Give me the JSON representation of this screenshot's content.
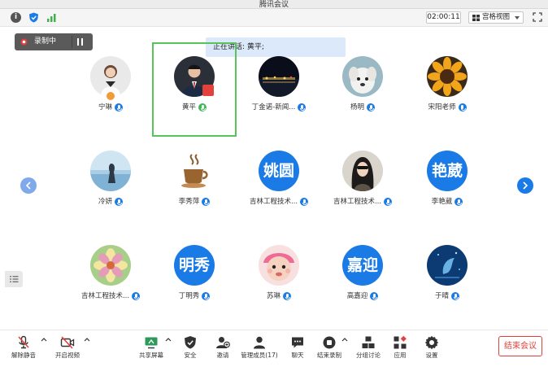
{
  "window": {
    "title": "腾讯会议"
  },
  "toolbar": {
    "timer": "02:00:11",
    "view_label": "宫格视图"
  },
  "recording": {
    "label": "录制中"
  },
  "speaking": {
    "text": "正在讲话: 黄平;"
  },
  "participants": [
    {
      "name": "宁琳",
      "avatar": "photo-woman"
    },
    {
      "name": "黄平",
      "avatar": "photo-man"
    },
    {
      "name": "丁金诺-新闻...",
      "avatar": "photo-night"
    },
    {
      "name": "杨明",
      "avatar": "photo-dog"
    },
    {
      "name": "宋阳老师",
      "avatar": "photo-sunflower"
    },
    {
      "name": "冷妍",
      "avatar": "photo-ocean"
    },
    {
      "name": "李秀萍",
      "avatar": "photo-coffee"
    },
    {
      "name": "吉林工程技术...",
      "avatar_text": "姚圆"
    },
    {
      "name": "吉林工程技术...",
      "avatar": "photo-girl"
    },
    {
      "name": "李艳葳",
      "avatar_text": "艳葳"
    },
    {
      "name": "吉林工程技术...",
      "avatar": "photo-flower"
    },
    {
      "name": "丁明秀",
      "avatar_text": "明秀"
    },
    {
      "name": "苏琳",
      "avatar": "photo-baby"
    },
    {
      "name": "高嘉迎",
      "avatar_text": "嘉迎"
    },
    {
      "name": "于晴",
      "avatar": "photo-blue"
    }
  ],
  "bottom": {
    "unmute": "解除静音",
    "start_video": "开启视频",
    "share_screen": "共享屏幕",
    "security": "安全",
    "invite": "邀请",
    "manage_members": "管理成员(17)",
    "chat": "聊天",
    "end_recording": "结束录制",
    "breakout": "分组讨论",
    "apps": "应用",
    "settings": "设置",
    "end_meeting": "结束会议"
  },
  "colors": {
    "accent": "#1a7ae6",
    "active_speaker": "#58c358",
    "danger": "#e0403a"
  }
}
